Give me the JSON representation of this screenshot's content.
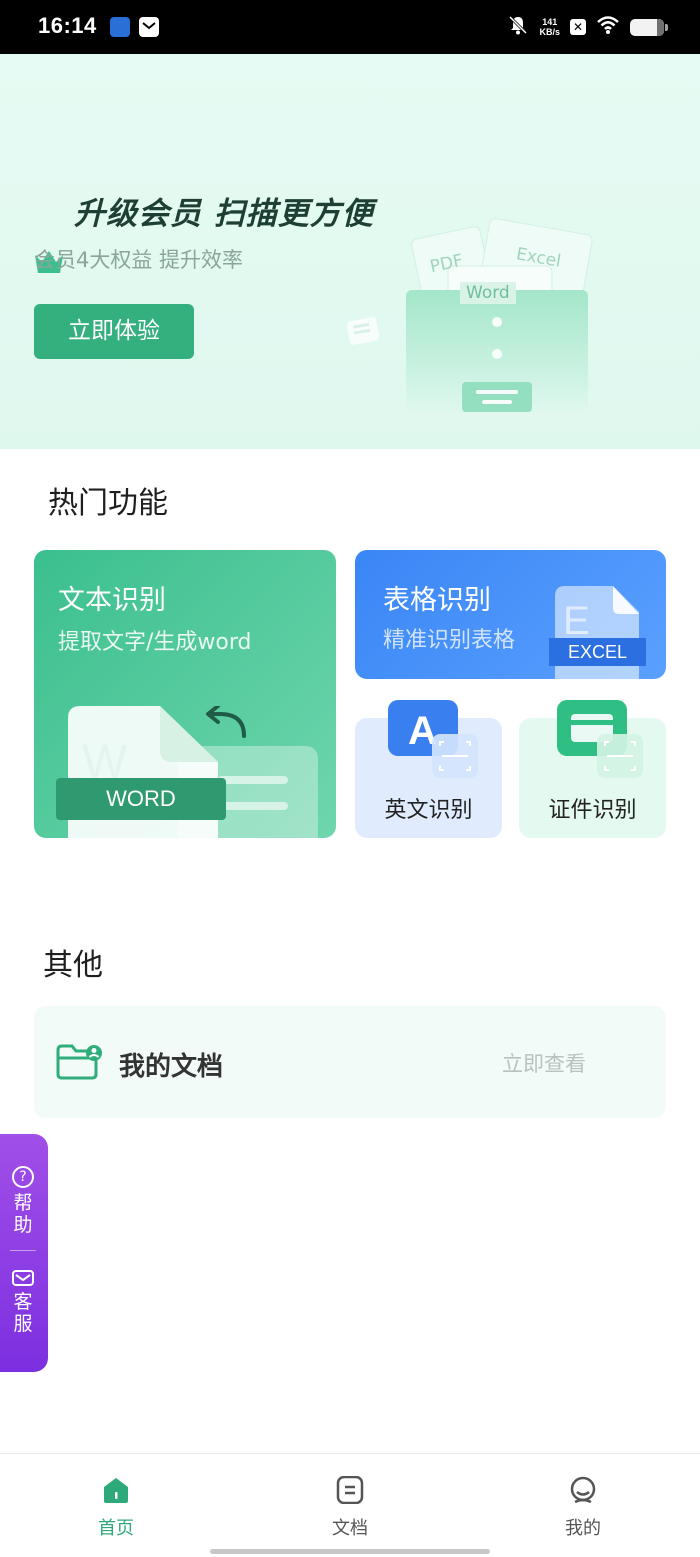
{
  "status_bar": {
    "time": "16:14",
    "speed_value": "141",
    "speed_unit": "KB/s"
  },
  "banner": {
    "title": "升级会员 扫描更方便",
    "subtitle": "会员4大权益 提升效率",
    "button_label": "立即体验",
    "illustration_labels": [
      "PDF",
      "Excel",
      "Word"
    ]
  },
  "hot_features": {
    "title": "热门功能",
    "text_recognition": {
      "title": "文本识别",
      "subtitle": "提取文字/生成word",
      "badge": "WORD"
    },
    "table_recognition": {
      "title": "表格识别",
      "subtitle": "精准识别表格",
      "badge": "EXCEL"
    },
    "english_recognition": {
      "label": "英文识别"
    },
    "id_recognition": {
      "label": "证件识别"
    }
  },
  "other": {
    "title": "其他",
    "my_docs": {
      "label": "我的文档",
      "action": "立即查看"
    }
  },
  "help_tab": {
    "help_label": "帮助",
    "service_label": "客服"
  },
  "bottom_nav": {
    "items": [
      {
        "label": "首页",
        "active": true
      },
      {
        "label": "文档",
        "active": false
      },
      {
        "label": "我的",
        "active": false
      }
    ]
  },
  "colors": {
    "accent_green": "#34b07f",
    "table_blue": "#3a86f5",
    "help_purple": "#8a3be6"
  }
}
